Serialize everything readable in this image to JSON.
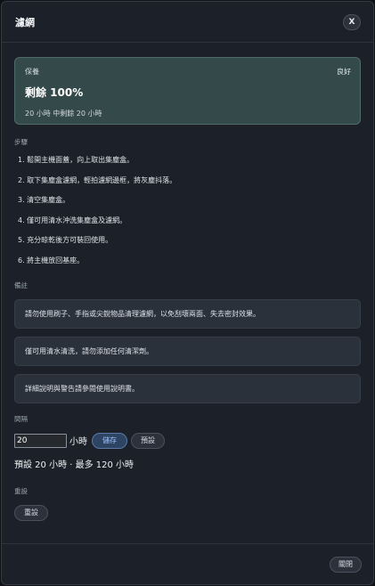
{
  "dialog": {
    "title": "濾網",
    "close_icon": "X"
  },
  "status": {
    "label": "保養",
    "state": "良好",
    "remaining": "剩餘 100%",
    "detail": "20 小時 中剩餘 20 小時"
  },
  "steps": {
    "label": "步驟",
    "items": [
      "1. 鬆開主機面蓋，向上取出集塵盒。",
      "2. 取下集塵盒濾網，輕拍濾網邊框，將灰塵抖落。",
      "3. 清空集塵盒。",
      "4. 僅可用清水沖洗集塵盒及濾網。",
      "5. 充分晾乾後方可裝回使用。",
      "6. 將主機放回基座。"
    ]
  },
  "notes": {
    "label": "備註",
    "items": [
      "請勿使用刷子、手指或尖銳物品清理濾網，以免刮壞兩面、失去密封效果。",
      "僅可用清水清洗，請勿添加任何清潔劑。",
      "詳細說明與警告請參閱使用說明書。"
    ]
  },
  "interval": {
    "label": "間隔",
    "value": "20",
    "unit": "小時",
    "save_label": "儲存",
    "preset_label": "預設",
    "hint": "預設 20 小時 · 最多 120 小時"
  },
  "reset": {
    "label": "重設",
    "button_label": "重設"
  },
  "footer": {
    "close_label": "關閉"
  }
}
